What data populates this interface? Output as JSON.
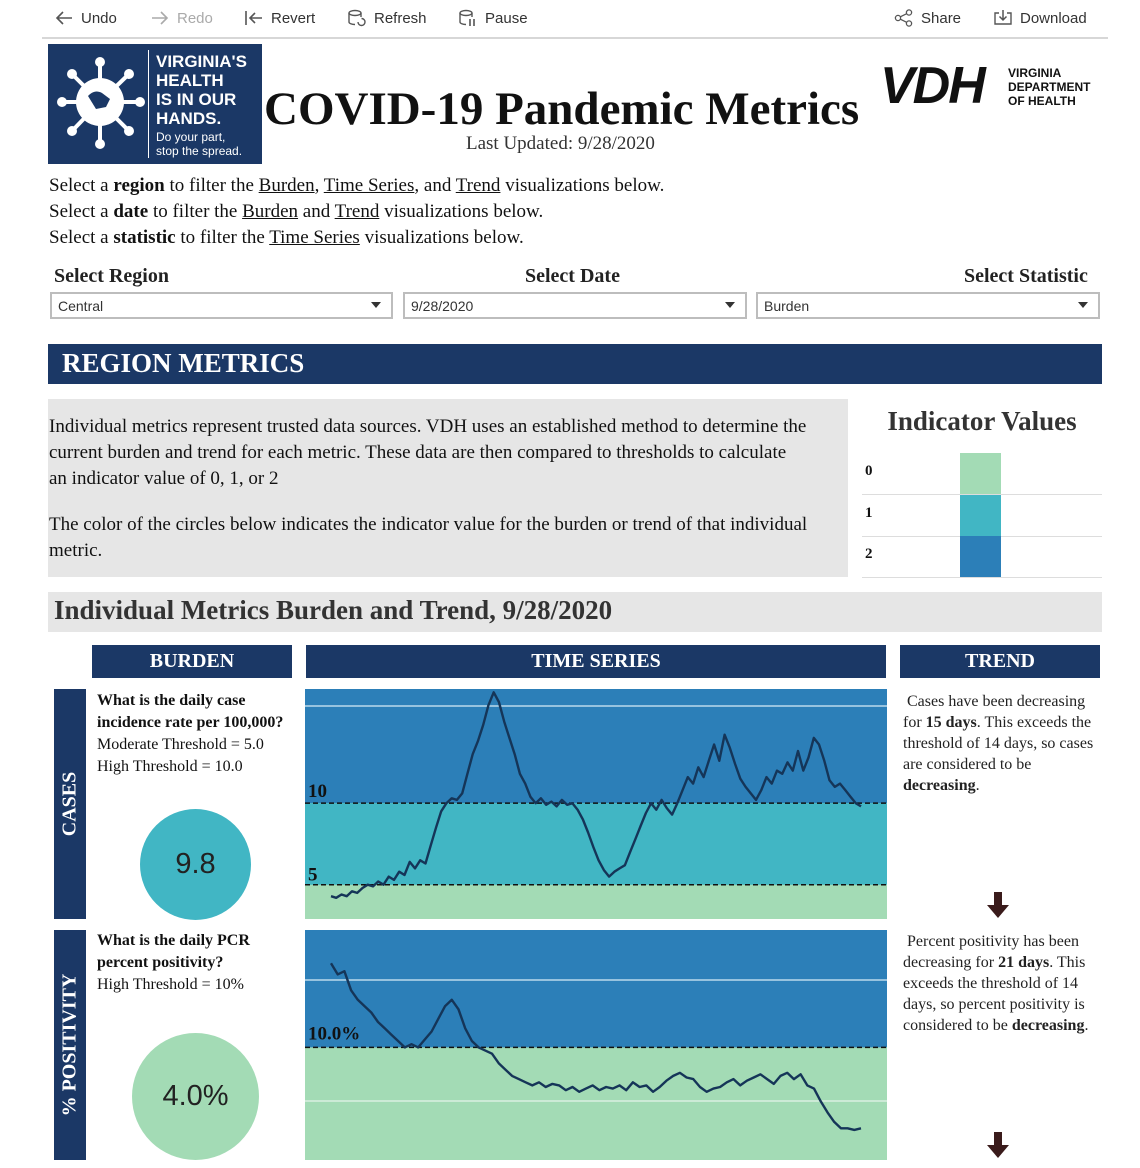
{
  "toolbar": {
    "undo": "Undo",
    "redo": "Redo",
    "revert": "Revert",
    "refresh": "Refresh",
    "pause": "Pause",
    "share": "Share",
    "download": "Download"
  },
  "logo": {
    "line1": "VIRGINIA'S",
    "line2": "HEALTH",
    "line3": "IS IN OUR",
    "line4": "HANDS.",
    "sub1": "Do your part,",
    "sub2": "stop the spread."
  },
  "header": {
    "title": "COVID-19 Pandemic Metrics",
    "last_updated": "Last Updated: 9/28/2020"
  },
  "vdh": {
    "letters": "VDH",
    "line1": "VIRGINIA",
    "line2": "DEPARTMENT",
    "line3": "OF HEALTH"
  },
  "instructions": {
    "l1_a": "Select a ",
    "l1_b": "region",
    "l1_c": " to filter the ",
    "l1_d": "Burden",
    "l1_e": ", ",
    "l1_f": "Time Series",
    "l1_g": ", and ",
    "l1_h": "Trend",
    "l1_i": " visualizations below.",
    "l2_a": "Select a ",
    "l2_b": "date",
    "l2_c": " to filter the ",
    "l2_d": "Burden",
    "l2_e": " and ",
    "l2_f": "Trend",
    "l2_g": " visualizations below.",
    "l3_a": "Select a ",
    "l3_b": "statistic",
    "l3_c": " to filter the ",
    "l3_d": "Time Series",
    "l3_e": " visualizations below."
  },
  "filters": {
    "region_label": "Select Region",
    "region_value": "Central",
    "date_label": "Select Date",
    "date_value": "9/28/2020",
    "stat_label": "Select Statistic",
    "stat_value": "Burden"
  },
  "region_metrics": {
    "banner": "REGION METRICS",
    "p1": "Individual metrics represent trusted data sources. VDH uses an established method to determine the current burden and trend for each metric. These data are then compared to thresholds to calculate an indicator value of 0, 1, or 2",
    "p2": "The color of the circles below indicates the indicator value for the burden or trend of that individual metric."
  },
  "indicator": {
    "title": "Indicator Values",
    "rows": [
      {
        "label": "0",
        "color": "#a3dbb5"
      },
      {
        "label": "1",
        "color": "#41b6c4"
      },
      {
        "label": "2",
        "color": "#2c7fb8"
      }
    ]
  },
  "metrics": {
    "heading": "Individual Metrics Burden and Trend, 9/28/2020",
    "col_burden": "BURDEN",
    "col_series": "TIME SERIES",
    "col_trend": "TREND",
    "cases": {
      "side_label": "CASES",
      "question": "What is the daily case incidence rate per 100,000?",
      "moderate": "Moderate Threshold = 5.0",
      "high": "High Threshold = 10.0",
      "value": "9.8",
      "circle_color": "#41b6c4",
      "tick_high": "10",
      "tick_mod": "5",
      "trend_a": "Cases have been decreasing for ",
      "trend_b": "15 days",
      "trend_c": ". This exceeds the threshold of 14 days, so cases are considered to be ",
      "trend_d": "decreasing",
      "trend_e": "."
    },
    "positivity": {
      "side_label": "% POSITIVITY",
      "question": "What is the daily PCR percent positivity?",
      "high": "High Threshold = 10%",
      "value": "4.0%",
      "circle_color": "#a3dbb5",
      "tick_high": "10.0%",
      "trend_a": "Percent positivity has been decreasing for ",
      "trend_b": "21 days",
      "trend_c": ". This exceeds the threshold of 14 days, so percent positivity is considered to be ",
      "trend_d": "decreasing",
      "trend_e": "."
    }
  },
  "chart_data": [
    {
      "type": "line",
      "series": [
        {
          "values": [
            4.3,
            4.2,
            4.4,
            4.3,
            4.6,
            4.5,
            4.8,
            5.0,
            4.9,
            5.2,
            5.0,
            5.5,
            5.3,
            5.8,
            5.6,
            6.4,
            6.0,
            6.5,
            6.3,
            7.4,
            8.5,
            9.5,
            10.0,
            10.3,
            10.2,
            10.6,
            11.8,
            13.0,
            13.8,
            14.8,
            16.0,
            16.8,
            16.2,
            15.0,
            14.0,
            13.0,
            11.8,
            11.2,
            10.4,
            10.0,
            10.3,
            9.9,
            10.1,
            9.8,
            10.2,
            9.9,
            10.0,
            9.6,
            9.0,
            8.2,
            7.3,
            6.5,
            5.9,
            5.5,
            5.8,
            6.0,
            6.2,
            7.0,
            7.8,
            8.6,
            9.4,
            10.0,
            9.6,
            10.2,
            9.7,
            9.3,
            10.0,
            10.8,
            11.6,
            11.2,
            12.2,
            11.6,
            12.6,
            13.6,
            12.6,
            14.2,
            13.4,
            12.4,
            11.5,
            11.0,
            10.6,
            10.2,
            10.8,
            11.6,
            11.2,
            12.0,
            11.8,
            12.5,
            12.0,
            13.2,
            12.0,
            12.8,
            14.0,
            13.6,
            12.6,
            11.4,
            11.0,
            11.2,
            10.8,
            10.4,
            10.0,
            9.8
          ]
        }
      ],
      "ylim": [
        2.9,
        17
      ],
      "thresholds": [
        5,
        10
      ]
    },
    {
      "type": "line",
      "series": [
        {
          "values": [
            15.3,
            14.6,
            14.8,
            13.6,
            13.0,
            12.6,
            12.2,
            11.6,
            11.2,
            10.8,
            10.4,
            10.0,
            10.2,
            10.0,
            10.5,
            11.0,
            11.8,
            12.6,
            13.0,
            12.4,
            11.2,
            10.4,
            10.0,
            9.8,
            9.6,
            9.0,
            8.6,
            8.2,
            8.0,
            7.8,
            7.6,
            7.8,
            7.5,
            7.7,
            7.6,
            7.3,
            7.5,
            7.2,
            7.4,
            7.6,
            7.3,
            7.5,
            7.4,
            7.6,
            7.3,
            7.8,
            7.5,
            7.6,
            7.2,
            7.5,
            7.9,
            8.2,
            8.4,
            8.1,
            8.0,
            7.5,
            7.2,
            7.4,
            7.5,
            7.8,
            8.0,
            7.6,
            7.9,
            8.1,
            8.3,
            8.0,
            7.7,
            8.2,
            8.4,
            8.0,
            8.3,
            7.6,
            7.4,
            6.6,
            5.9,
            5.3,
            4.9,
            4.9,
            4.8,
            4.9
          ]
        }
      ],
      "ylim": [
        2.9,
        17.4
      ],
      "thresholds": [
        10
      ]
    }
  ]
}
